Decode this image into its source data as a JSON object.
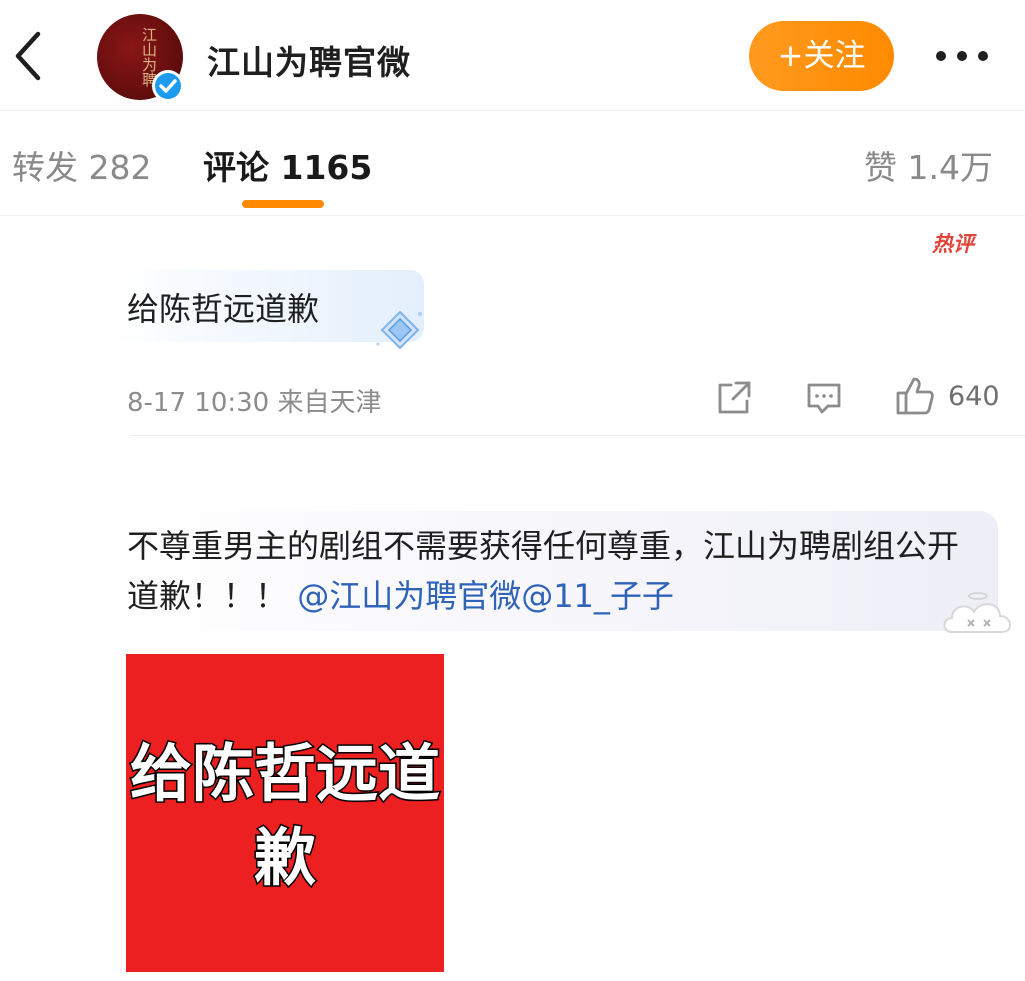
{
  "header": {
    "account_name": "江山为聘官微",
    "avatar_calligraphy": "江山为聘",
    "follow_label": "+关注"
  },
  "tabs": {
    "repost": "转发 282",
    "comments": "评论 1165",
    "likes": "赞 1.4万"
  },
  "badge": {
    "hot": "热评"
  },
  "comment1": {
    "text": "给陈哲远道歉",
    "meta": "8-17 10:30 来自天津",
    "like_count": "640"
  },
  "comment2": {
    "text": "不尊重男主的剧组不需要获得任何尊重，江山为聘剧组公开道歉！！！",
    "mention": "@江山为聘官微@11_子子",
    "image_text": "给陈哲远道歉"
  },
  "colors": {
    "accent": "#ff8a00",
    "mention": "#2e63b8",
    "hot_badge": "#e0443a",
    "verified": "#1d9bf0",
    "image_bg": "#ec2020"
  },
  "icons": {
    "back": "chevron-left-icon",
    "more": "more-dots-icon",
    "verified": "verified-badge-icon",
    "share": "share-icon",
    "reply": "comment-icon",
    "like": "thumbs-up-icon",
    "diamond": "diamond-icon",
    "cloud": "cloud-sticker-icon"
  }
}
